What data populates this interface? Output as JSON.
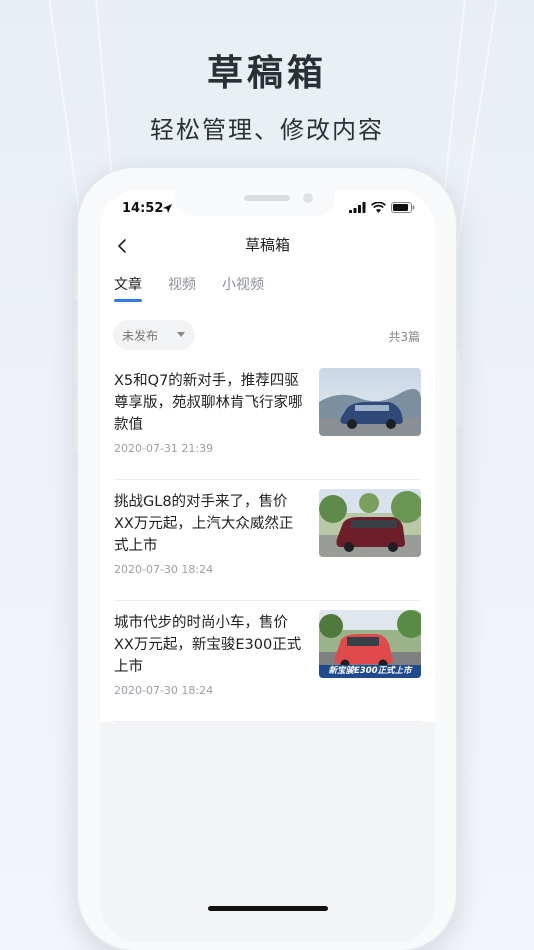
{
  "promo": {
    "title": "草稿箱",
    "subtitle": "轻松管理、修改内容"
  },
  "status_bar": {
    "time": "14:52",
    "icons": [
      "location-arrow-icon",
      "cellular-signal-icon",
      "wifi-icon",
      "battery-icon"
    ]
  },
  "nav": {
    "back_icon": "chevron-left-icon",
    "title": "草稿箱"
  },
  "tabs": [
    {
      "label": "文章",
      "active": true
    },
    {
      "label": "视频",
      "active": false
    },
    {
      "label": "小视频",
      "active": false
    }
  ],
  "filter": {
    "selected": "未发布",
    "icon": "caret-down-icon"
  },
  "count_text": "共3篇",
  "accent_color": "#2f7de1",
  "articles": [
    {
      "title": "X5和Q7的新对手，推荐四驱尊享版，苑叔聊林肯飞行家哪款值",
      "date": "2020-07-31 21:39",
      "thumb_caption": ""
    },
    {
      "title": "挑战GL8的对手来了，售价XX万元起，上汽大众威然正式上市",
      "date": "2020-07-30 18:24",
      "thumb_caption": ""
    },
    {
      "title": "城市代步的时尚小车，售价XX万元起，新宝骏E300正式上市",
      "date": "2020-07-30 18:24",
      "thumb_caption": "新宝骏E300正式上市"
    }
  ]
}
